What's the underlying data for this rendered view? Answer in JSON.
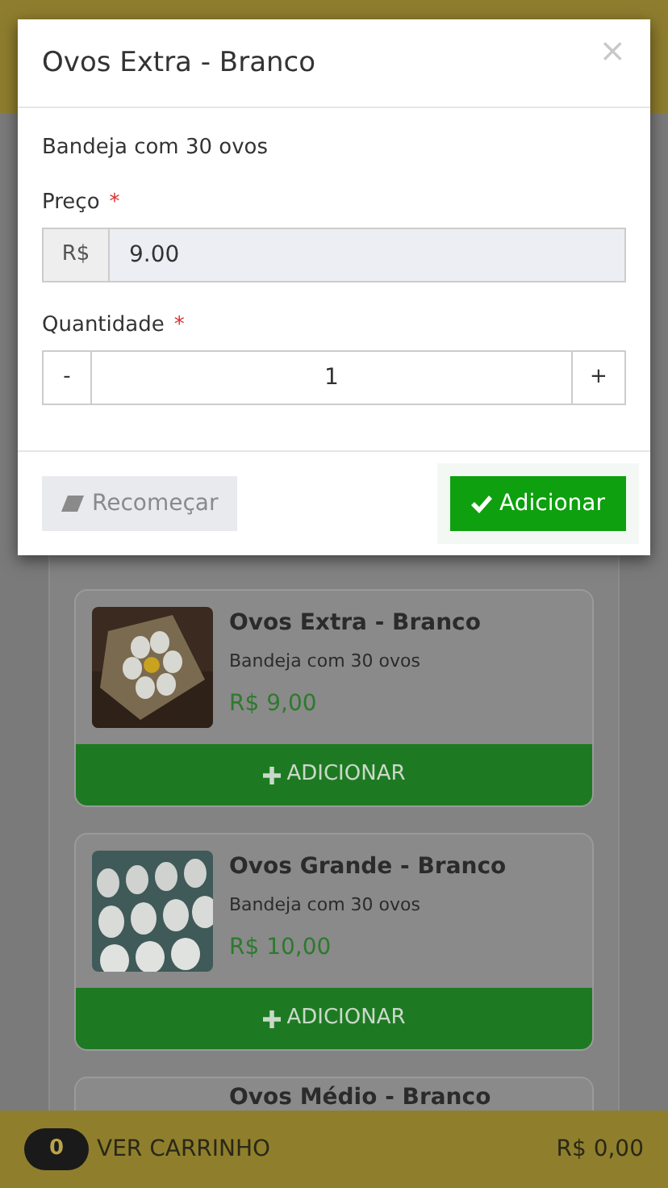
{
  "modal": {
    "title": "Ovos Extra - Branco",
    "close": "×",
    "description": "Bandeja com 30 ovos",
    "price": {
      "label": "Preço",
      "required_mark": "*",
      "prefix": "R$",
      "value": "9.00"
    },
    "quantity": {
      "label": "Quantidade",
      "required_mark": "*",
      "decrement": "-",
      "value": "1",
      "increment": "+"
    },
    "buttons": [
      {
        "kind": "secondary",
        "label": "Recomeçar"
      },
      {
        "kind": "primary",
        "label": "Adicionar"
      }
    ]
  },
  "products": [
    {
      "name": "Ovos Extra - Branco",
      "description": "Bandeja com 30 ovos",
      "price": "R$ 9,00",
      "button": "ADICIONAR",
      "kind": "picture"
    },
    {
      "name": "Ovos Grande - Branco",
      "description": "Bandeja com 30 ovos",
      "price": "R$ 10,00",
      "button": "ADICIONAR",
      "kind": "picture"
    },
    {
      "name": "Ovos Médio - Branco"
    }
  ],
  "cart_bar": {
    "count": "0",
    "label": "VER CARRINHO",
    "total": "R$ 0,00"
  }
}
